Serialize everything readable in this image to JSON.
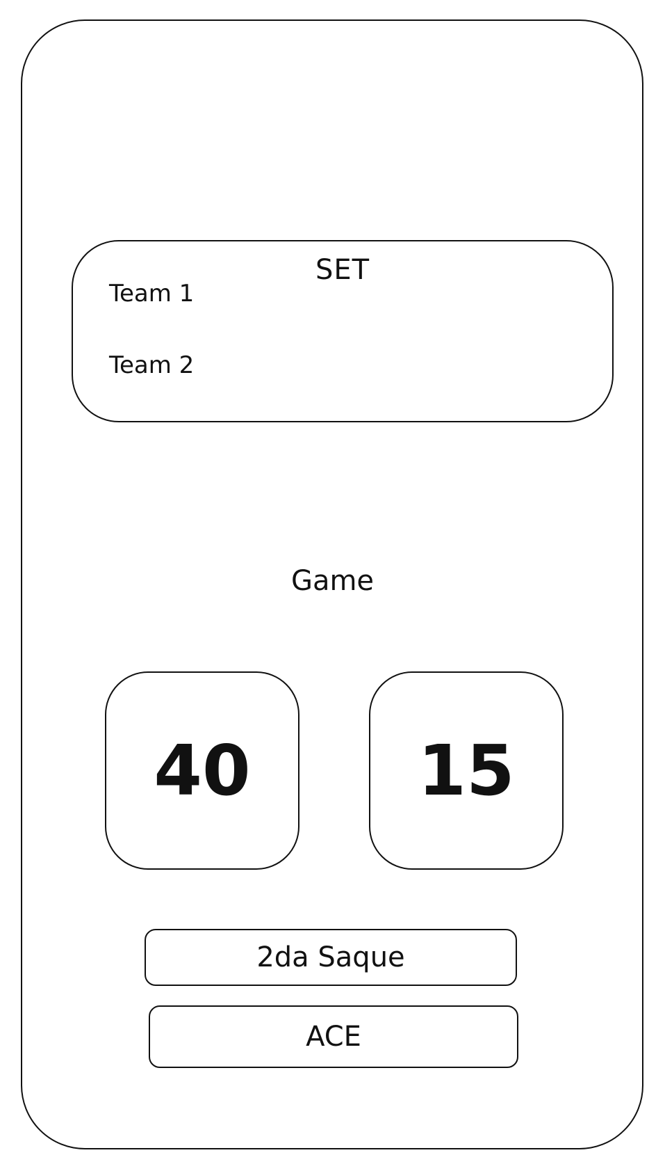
{
  "set_panel": {
    "title": "SET",
    "teams": [
      "Team 1",
      "Team 2"
    ]
  },
  "game": {
    "label": "Game",
    "scores": [
      "40",
      "15"
    ]
  },
  "actions": {
    "second_serve_label": "2da Saque",
    "ace_label": "ACE"
  }
}
